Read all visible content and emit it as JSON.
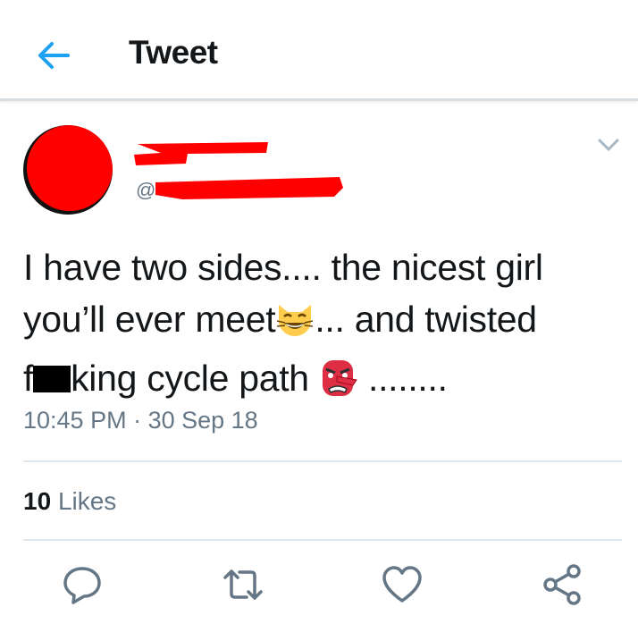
{
  "header": {
    "title": "Tweet",
    "back_icon": "arrow-left-icon",
    "accent": "#1da1f2"
  },
  "author": {
    "handle_prefix": "@"
  },
  "tweet": {
    "line1": "I have two sides.... the nicest girl",
    "line2a": "you’ll ever meet",
    "line2b": "... and twisted",
    "line3a": "f",
    "line3b": "king cycle path ",
    "line3c": " ........"
  },
  "meta": {
    "time": "10:45 PM",
    "sep": " · ",
    "date": "30 Sep 18"
  },
  "stats": {
    "likes_count": "10",
    "likes_label": "Likes"
  },
  "actions": [
    "reply-icon",
    "retweet-icon",
    "like-icon",
    "share-icon"
  ]
}
